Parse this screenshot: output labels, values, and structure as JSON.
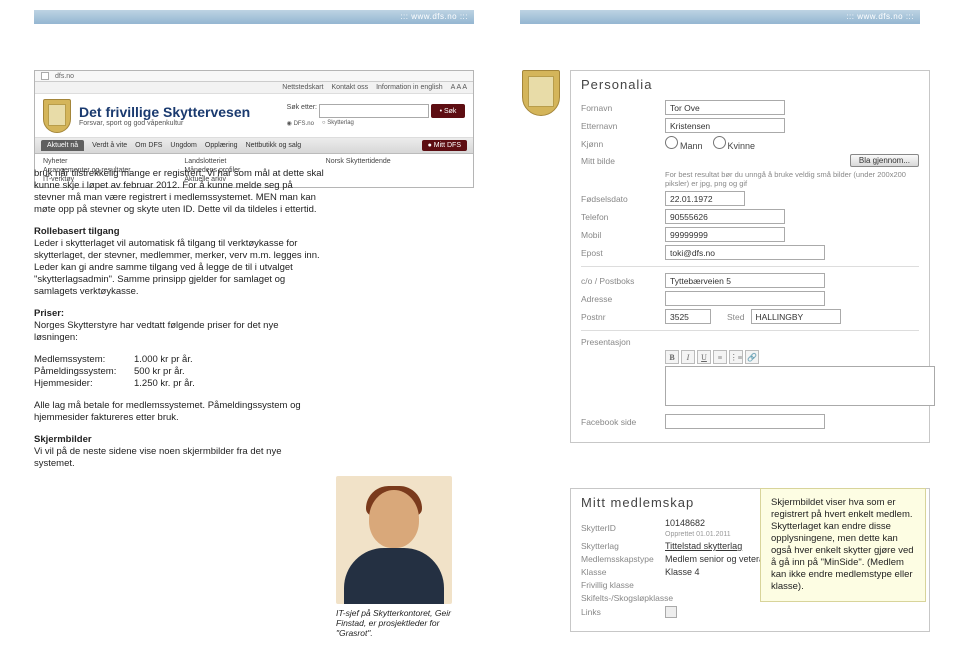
{
  "stripes": {
    "left": "::: www.dfs.no :::",
    "right": "::: www.dfs.no :::"
  },
  "mini_site": {
    "url": "dfs.no",
    "topstrip": [
      "Nettstedskart",
      "Kontakt oss",
      "Information in english",
      "A A A"
    ],
    "title": "Det frivillige Skyttervesen",
    "tagline": "Forsvar, sport og god våpenkultur",
    "search_label": "Søk etter:",
    "search_btn": "• Søk",
    "search_opts": [
      "DFS.no",
      "Skytterlag"
    ],
    "nav": [
      "Aktuelt nå",
      "Verdt å vite",
      "Om DFS",
      "Ungdom",
      "Opplæring",
      "Nettbutikk og salg"
    ],
    "nav_mitt": "● Mitt DFS",
    "subnav": [
      "Nyheter",
      "Landslotteriet",
      "Norsk Skyttertidende",
      "Arrangementer og resultater",
      "Månedens profiler",
      "",
      "IT-verktøy",
      "Aktuelle arkiv",
      ""
    ]
  },
  "body": {
    "p1": "bruk når tilstrekkelig mange er registrert. Vi har som mål at dette skal kunne skje i løpet av februar 2012. For å kunne melde seg på stevner må man være registrert i medlemssystemet. MEN man kan møte opp på stevner og skyte uten ID. Dette vil da tildeles i ettertid.",
    "h2a": "Rollebasert tilgang",
    "p2": "Leder i skytterlaget vil automatisk få tilgang til verktøykasse for skytterlaget, der stevner, medlemmer, merker, verv m.m. legges inn. Leder kan gi andre samme tilgang ved å legge de til i utvalget \"skytterlagsadmin\". Samme prinsipp gjelder for samlaget og samlagets verktøykasse.",
    "h2b": "Priser:",
    "p3": "Norges Skytterstyre har vedtatt følgende priser for det nye løsningen:",
    "prices": [
      [
        "Medlemssystem:",
        "1.000 kr pr år."
      ],
      [
        "Påmeldingssystem:",
        "500 kr pr år."
      ],
      [
        "Hjemmesider:",
        "1.250 kr. pr år."
      ]
    ],
    "p4": "Alle lag må betale for medlemssystemet. Påmeldingssystem og hjemmesider faktureres etter bruk.",
    "h2c": "Skjermbilder",
    "p5": "Vi vil på de neste sidene vise noen skjermbilder fra det nye systemet.",
    "caption": "IT-sjef på Skytterkontoret, Geir Finstad, er prosjektleder for \"Grasrot\"."
  },
  "personalia": {
    "title": "Personalia",
    "name_l": "Fornavn",
    "name_v": "Tor Ove",
    "last_l": "Etternavn",
    "last_v": "Kristensen",
    "kjonn_l": "Kjønn",
    "kjonn_opts": [
      "Mann",
      "Kvinne"
    ],
    "bilde_l": "Mitt bilde",
    "bilde_btn": "Bla gjennom...",
    "bilde_hint": "For best resultat bør du unngå å bruke veldig små bilder (under 200x200 piksler) er jpg, png og gif",
    "fdato_l": "Fødselsdato",
    "fdato_v": "22.01.1972",
    "tlf_l": "Telefon",
    "tlf_v": "90555626",
    "mob_l": "Mobil",
    "mob_v": "99999999",
    "epost_l": "Epost",
    "epost_v": "toki@dfs.no",
    "co_l": "c/o / Postboks",
    "co_v": "Tyttebærveien 5",
    "adr_l": "Adresse",
    "post_l": "Postnr",
    "post_v": "3525",
    "sted_l": "Sted",
    "sted_v": "HALLINGBY",
    "pres_l": "Presentasjon",
    "fb_l": "Facebook side"
  },
  "medlemskap": {
    "title": "Mitt medlemskap",
    "sid_l": "SkytterID",
    "sid_v": "10148682",
    "sid_sub": "Opprettet 01.01.2011",
    "lag_l": "Skytterlag",
    "lag_v": "Tittelstad skytterlag",
    "type_l": "Medlemsskapstype",
    "type_v": "Medlem senior og veteran",
    "kl_l": "Klasse",
    "kl_v": "Klasse 4",
    "fri_l": "Frivillig klasse",
    "ski_l": "Skifelts-/Skogsløpklasse",
    "links_l": "Links"
  },
  "callout": "Skjermbildet viser hva som er registrert på hvert enkelt medlem. Skytterlaget kan endre disse opplysningene, men dette kan også hver enkelt skytter gjøre ved å gå inn på \"MinSide\". (Medlem kan ikke endre medlemstype eller klasse)."
}
